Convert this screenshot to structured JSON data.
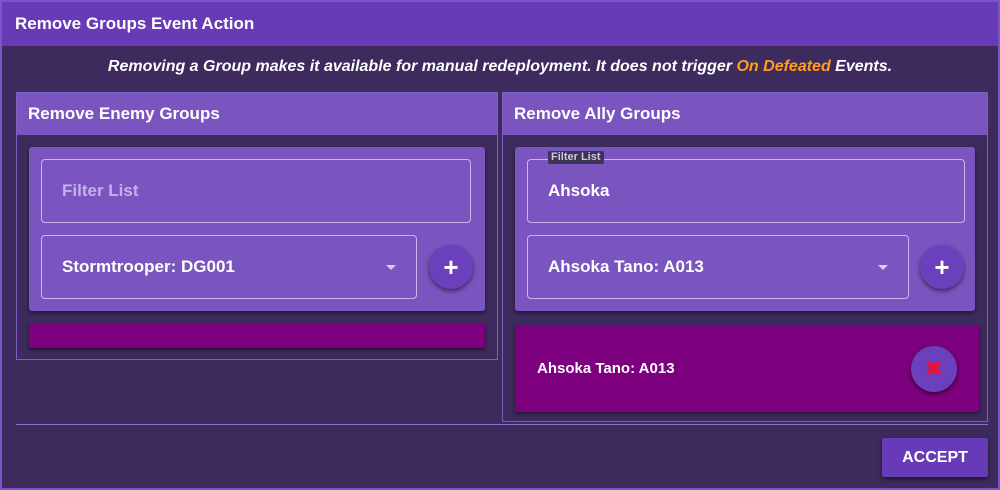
{
  "dialog": {
    "title": "Remove Groups Event Action",
    "info_prefix": "Removing a Group makes it available for manual redeployment. It does not trigger ",
    "info_highlight": "On Defeated",
    "info_suffix": " Events.",
    "accept_label": "ACCEPT"
  },
  "enemy": {
    "header": "Remove Enemy Groups",
    "filter_placeholder": "Filter List",
    "selected_group": "Stormtrooper: DG001",
    "add_icon": "+"
  },
  "ally": {
    "header": "Remove Ally Groups",
    "filter_label": "Filter List",
    "filter_value": "Ahsoka",
    "selected_group": "Ahsoka Tano: A013",
    "add_icon": "+",
    "removed": [
      {
        "label": "Ahsoka Tano: A013",
        "remove_icon": "✖"
      }
    ]
  },
  "colors": {
    "title_bar": "#673ab7",
    "background": "#3d2b5d",
    "panel_header": "#7b55bf",
    "item_bg": "#7d007e",
    "highlight": "#ff9f1a",
    "remove_icon": "#ee1133"
  }
}
